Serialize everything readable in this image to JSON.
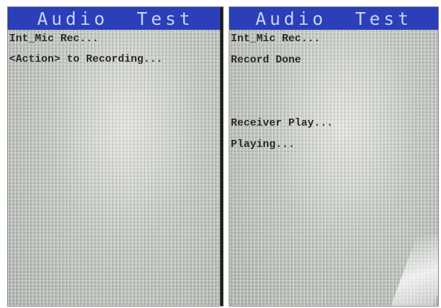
{
  "screens": [
    {
      "title": "Audio  Test",
      "lines": [
        "Int_Mic Rec...",
        "<Action> to Recording..."
      ]
    },
    {
      "title": "Audio  Test",
      "lines": [
        "Int_Mic Rec...",
        "Record Done",
        "Receiver Play...",
        "Playing..."
      ]
    }
  ],
  "colors": {
    "title_bar": "#2a3fb8",
    "title_text": "#c9d0ff",
    "screen_bg": "#c4c9c2",
    "text": "#2d2a2a"
  }
}
